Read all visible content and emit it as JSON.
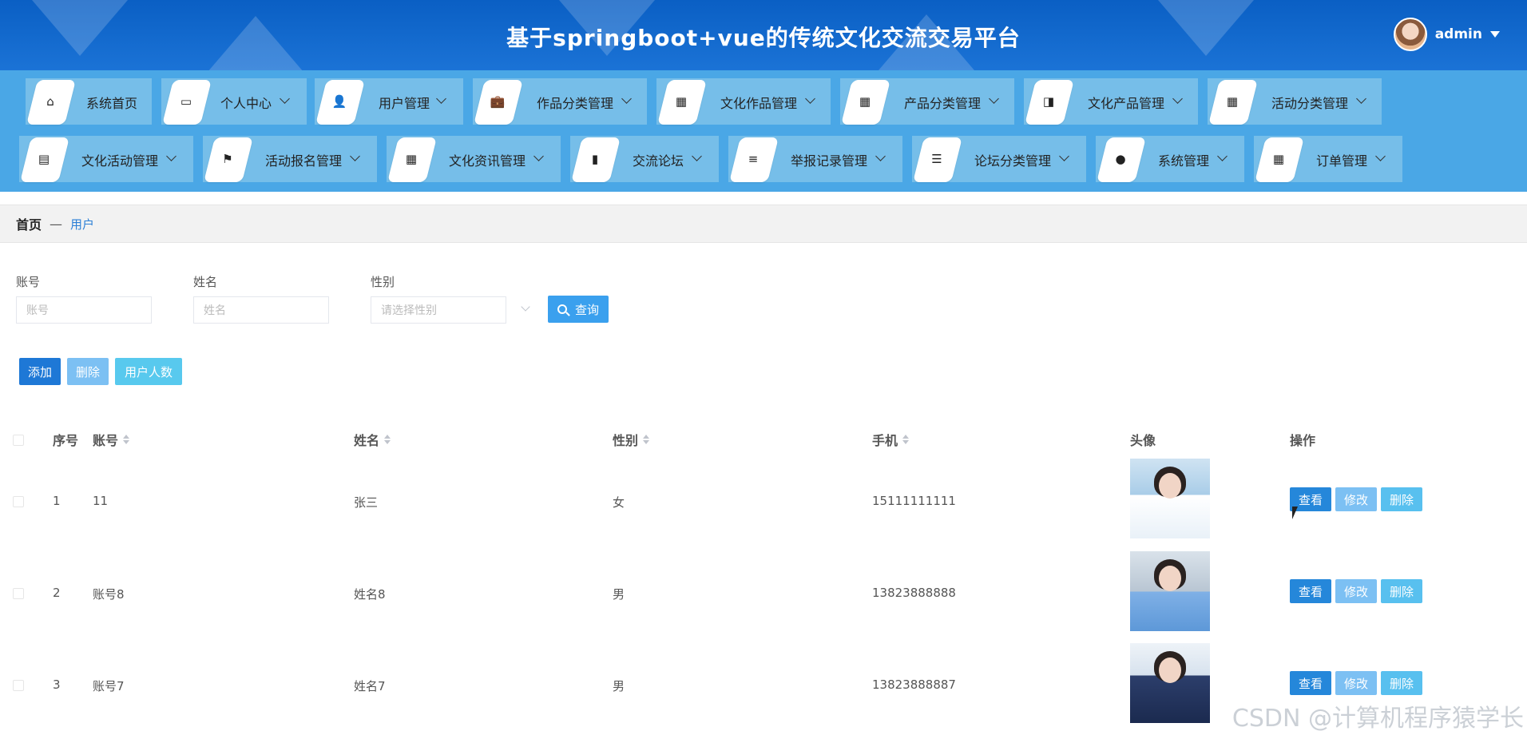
{
  "header": {
    "title": "基于springboot+vue的传统文化交流交易平台",
    "user": "admin"
  },
  "nav": {
    "row1": [
      {
        "label": "系统首页",
        "icon": "home-icon",
        "glyph": "⌂",
        "dropdown": false
      },
      {
        "label": "个人中心",
        "icon": "card-icon",
        "glyph": "▭",
        "dropdown": true
      },
      {
        "label": "用户管理",
        "icon": "user-icon",
        "glyph": "👤",
        "dropdown": true
      },
      {
        "label": "作品分类管理",
        "icon": "briefcase-icon",
        "glyph": "💼",
        "dropdown": true
      },
      {
        "label": "文化作品管理",
        "icon": "grid-icon",
        "glyph": "▦",
        "dropdown": true
      },
      {
        "label": "产品分类管理",
        "icon": "grid-icon",
        "glyph": "▦",
        "dropdown": true
      },
      {
        "label": "文化产品管理",
        "icon": "wallet-icon",
        "glyph": "◨",
        "dropdown": true
      },
      {
        "label": "活动分类管理",
        "icon": "grid-icon",
        "glyph": "▦",
        "dropdown": true
      }
    ],
    "row2": [
      {
        "label": "文化活动管理",
        "icon": "clipboard-icon",
        "glyph": "▤",
        "dropdown": true
      },
      {
        "label": "活动报名管理",
        "icon": "flag-icon",
        "glyph": "⚑",
        "dropdown": true
      },
      {
        "label": "文化资讯管理",
        "icon": "grid-icon",
        "glyph": "▦",
        "dropdown": true
      },
      {
        "label": "交流论坛",
        "icon": "book-icon",
        "glyph": "▮",
        "dropdown": true
      },
      {
        "label": "举报记录管理",
        "icon": "list-icon",
        "glyph": "≡",
        "dropdown": true
      },
      {
        "label": "论坛分类管理",
        "icon": "sliders-icon",
        "glyph": "☰",
        "dropdown": true
      },
      {
        "label": "系统管理",
        "icon": "pin-icon",
        "glyph": "●",
        "dropdown": true
      },
      {
        "label": "订单管理",
        "icon": "apps-icon",
        "glyph": "▦",
        "dropdown": true
      }
    ]
  },
  "breadcrumb": {
    "home": "首页",
    "separator": "—",
    "current": "用户"
  },
  "search": {
    "account_label": "账号",
    "account_placeholder": "账号",
    "name_label": "姓名",
    "name_placeholder": "姓名",
    "gender_label": "性别",
    "gender_placeholder": "请选择性别",
    "search_button": "查询"
  },
  "actions": {
    "add": "添加",
    "delete": "删除",
    "count": "用户人数"
  },
  "table": {
    "headers": {
      "index": "序号",
      "account": "账号",
      "name": "姓名",
      "gender": "性别",
      "phone": "手机",
      "avatar": "头像",
      "ops": "操作"
    },
    "rows": [
      {
        "index": "1",
        "account": "11",
        "name": "张三",
        "gender": "女",
        "phone": "15111111111"
      },
      {
        "index": "2",
        "account": "账号8",
        "name": "姓名8",
        "gender": "男",
        "phone": "13823888888"
      },
      {
        "index": "3",
        "account": "账号7",
        "name": "姓名7",
        "gender": "男",
        "phone": "13823888887"
      }
    ],
    "ops": {
      "view": "查看",
      "edit": "修改",
      "delete": "删除"
    }
  },
  "watermark": "CSDN @计算机程序猿学长",
  "colors": {
    "header": "#0a5fc4",
    "nav": "#4aa7e6",
    "primary": "#1e78d6",
    "link": "#2b7fd6"
  }
}
